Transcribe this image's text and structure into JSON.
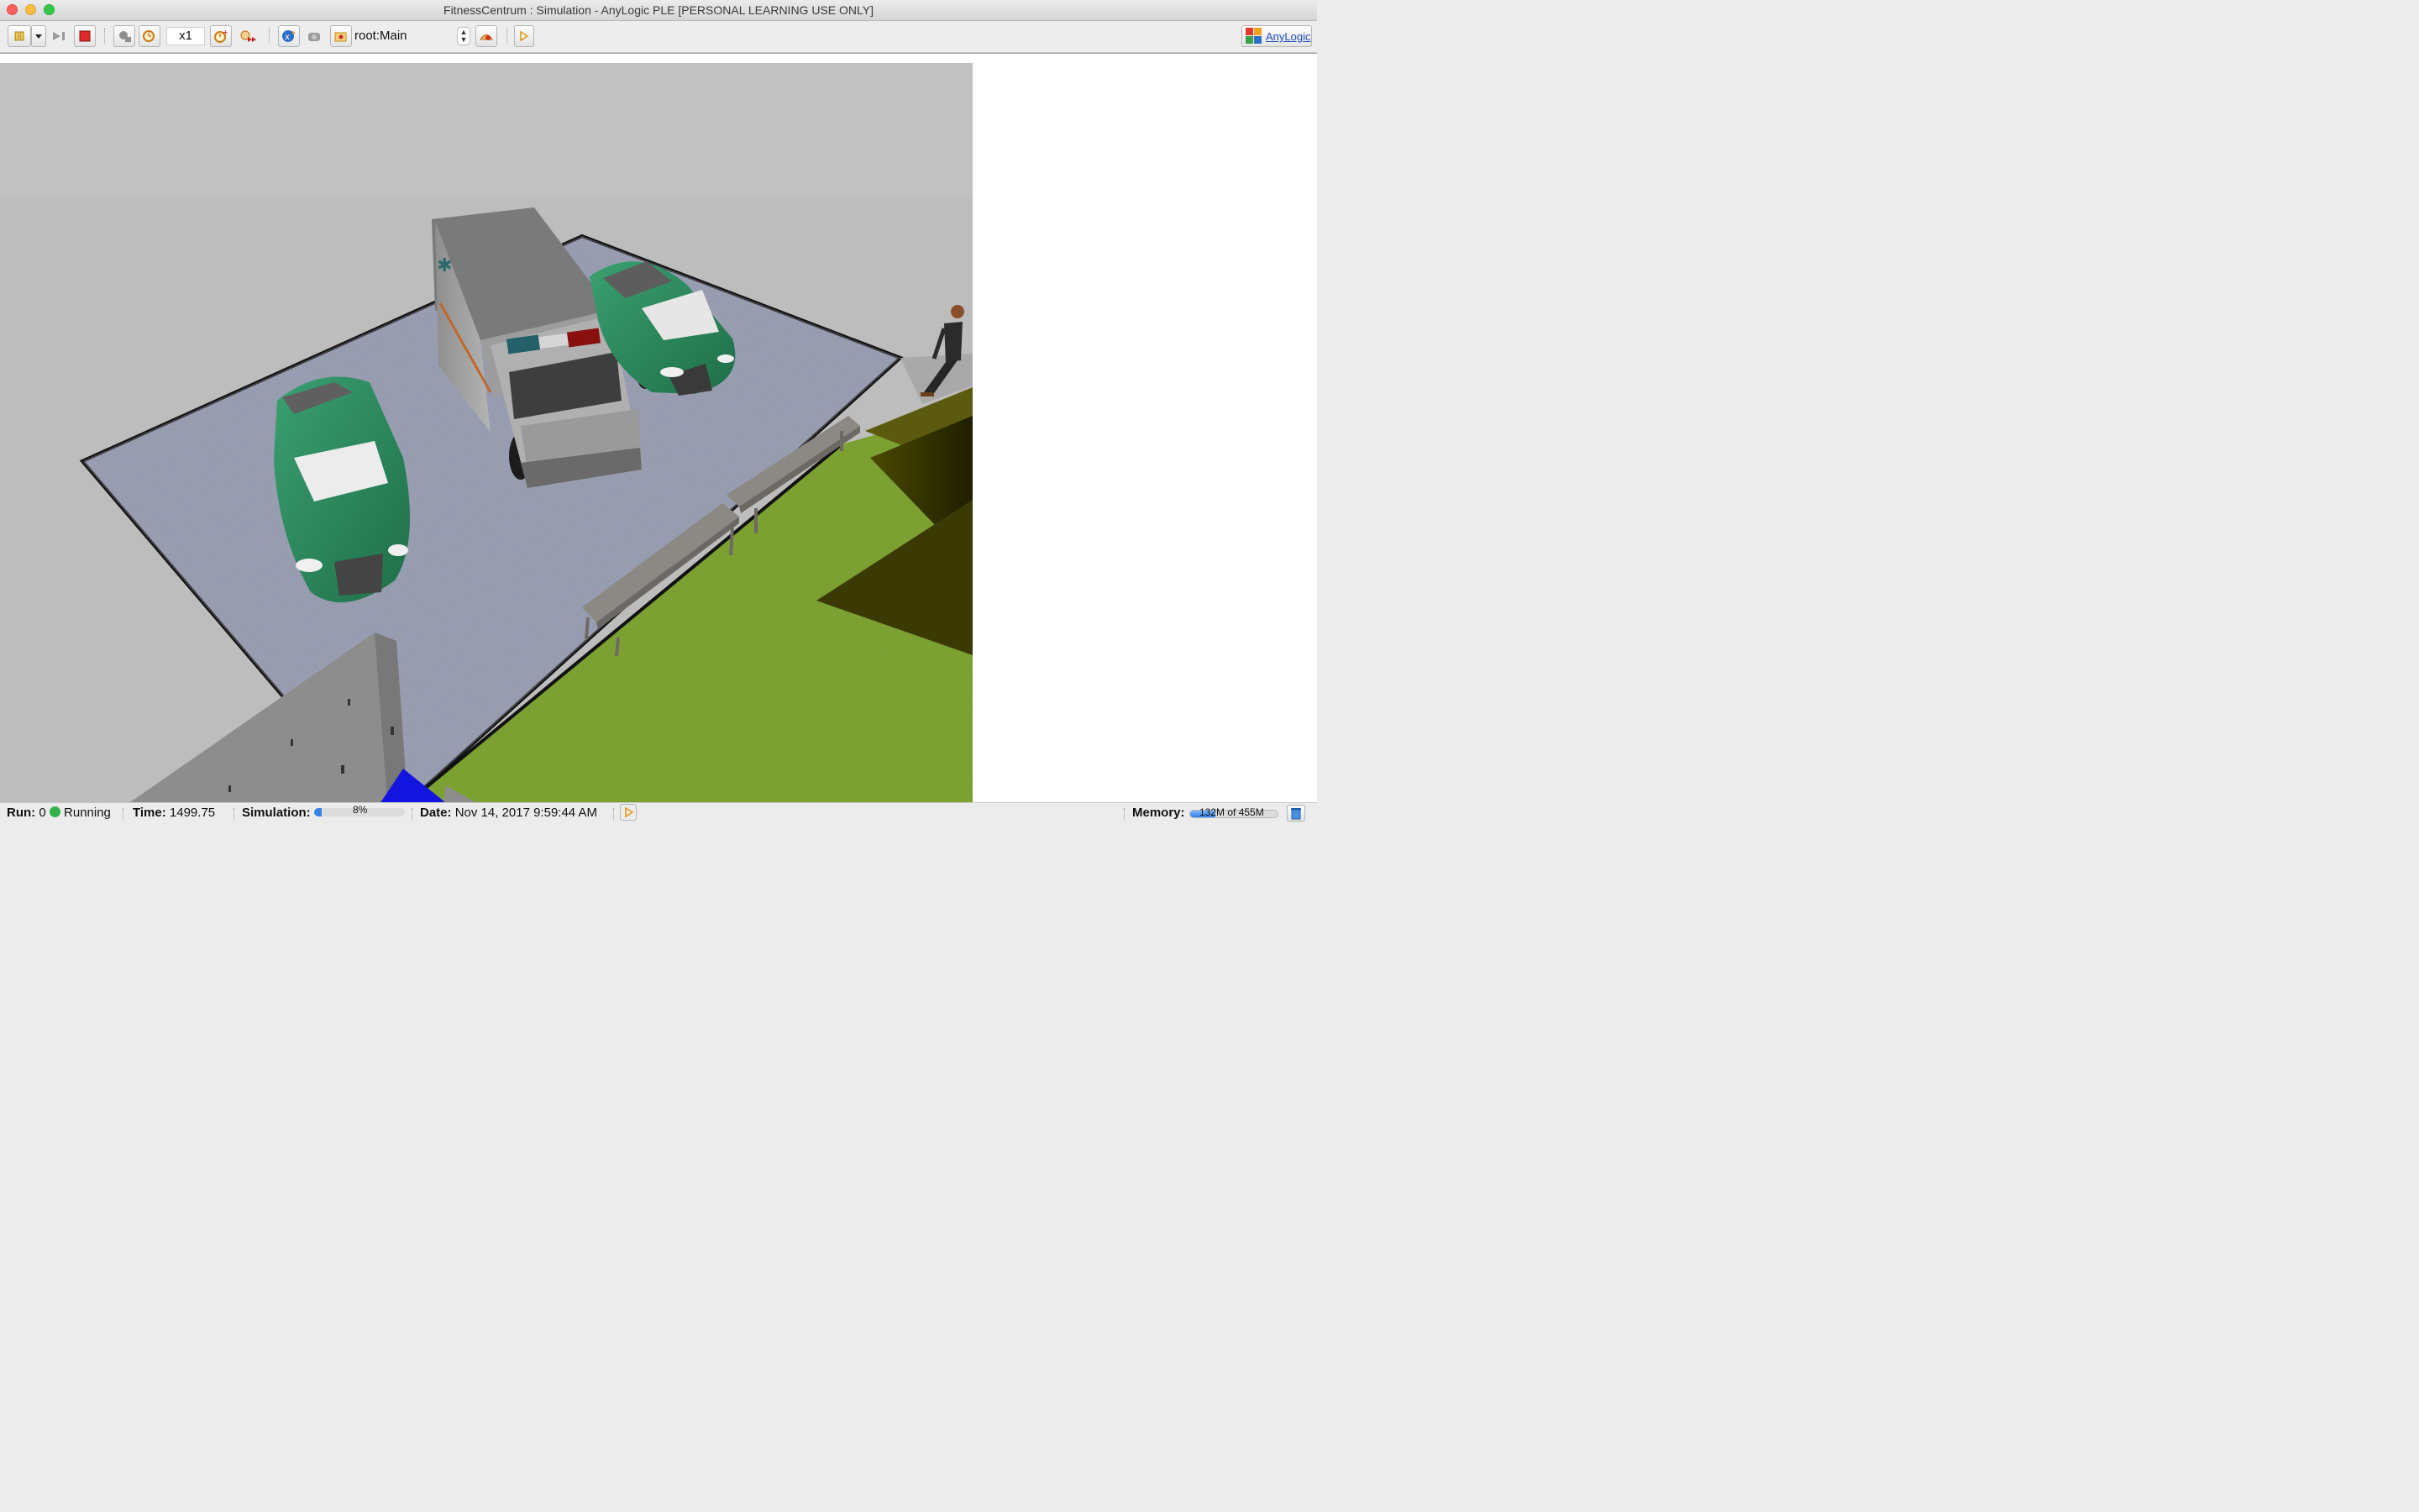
{
  "window": {
    "title": "FitnessCentrum : Simulation - AnyLogic PLE [PERSONAL LEARNING USE ONLY]"
  },
  "toolbar": {
    "speed_value": "x1",
    "agent_selector_value": "root:Main",
    "anylogic_link_label": "AnyLogic",
    "icons": [
      "pause-icon",
      "dropdown-arrow-icon",
      "step-icon",
      "stop-icon",
      "slow-down-icon",
      "real-time-icon",
      "speed-up-icon",
      "virtual-time-icon",
      "navigate-up-icon",
      "camera-icon",
      "agent-navigate-icon",
      "view-area-icon",
      "console-icon"
    ]
  },
  "status_bar": {
    "run_label": "Run:",
    "run_value": "0",
    "run_state": "Running",
    "time_label": "Time:",
    "time_value": "1499.75",
    "simulation_label": "Simulation:",
    "simulation_progress_percent": 8,
    "simulation_progress_text": "8%",
    "date_label": "Date:",
    "date_value": "Nov 14, 2017 9:59:44 AM",
    "memory_label": "Memory:",
    "memory_value": "132M of 455M",
    "memory_used_fraction": 0.29
  },
  "colors": {
    "sky": "#c1c1c1",
    "grass": "#6f9a2a",
    "car_green": "#2e8a5e",
    "ambulance_body": "#a8a8a8",
    "sim_progress": "#3a83e6",
    "memory_fill": "#2f7de6"
  }
}
